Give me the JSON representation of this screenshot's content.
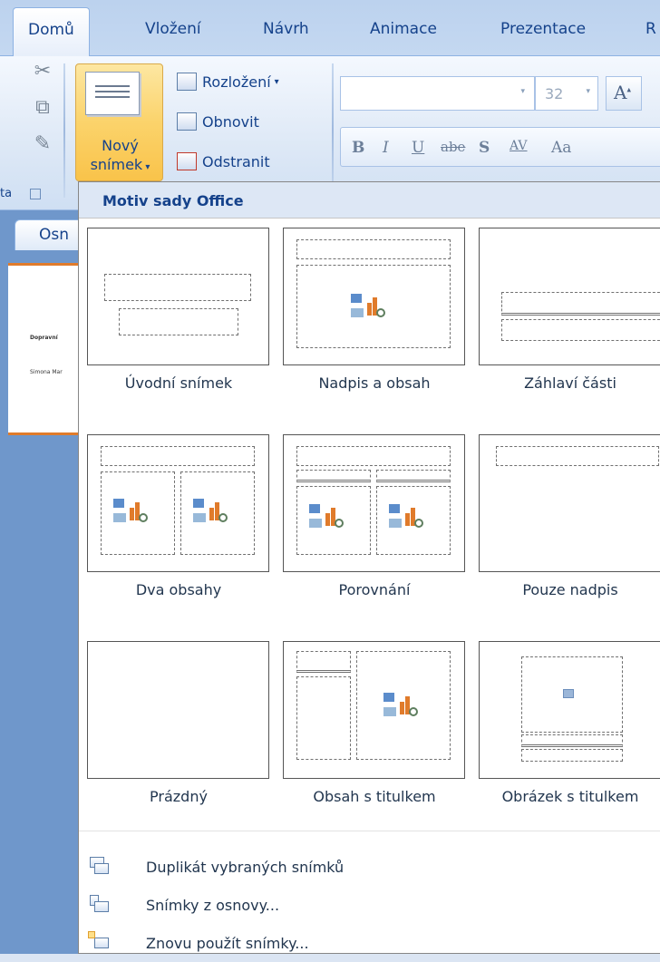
{
  "tabs": [
    "Domů",
    "Vložení",
    "Návrh",
    "Animace",
    "Prezentace",
    "R"
  ],
  "ribbon": {
    "new_slide_line1": "Nový",
    "new_slide_line2": "snímek",
    "layout_label": "Rozložení",
    "reset_label": "Obnovit",
    "delete_label": "Odstranit",
    "font_size": "32",
    "group_footer": "ta",
    "format_buttons": [
      "B",
      "I",
      "U",
      "abe",
      "S",
      "AV",
      "Aa"
    ]
  },
  "left_pane": {
    "tab_label": "Osn",
    "thumb_title": "Dopravní",
    "thumb_sub": "Simona Mar"
  },
  "menu": {
    "heading": "Motiv sady Office",
    "layouts": [
      "Úvodní snímek",
      "Nadpis a obsah",
      "Záhlaví části",
      "Dva obsahy",
      "Porovnání",
      "Pouze nadpis",
      "Prázdný",
      "Obsah s titulkem",
      "Obrázek s titulkem"
    ],
    "items": [
      "Duplikát vybraných snímků",
      "Snímky z osnovy...",
      "Znovu použít snímky..."
    ]
  },
  "colors": {
    "ribbon_text": "#15428b",
    "new_slide_active": "#fbd36b",
    "slide_accent": "#e07b2b"
  }
}
